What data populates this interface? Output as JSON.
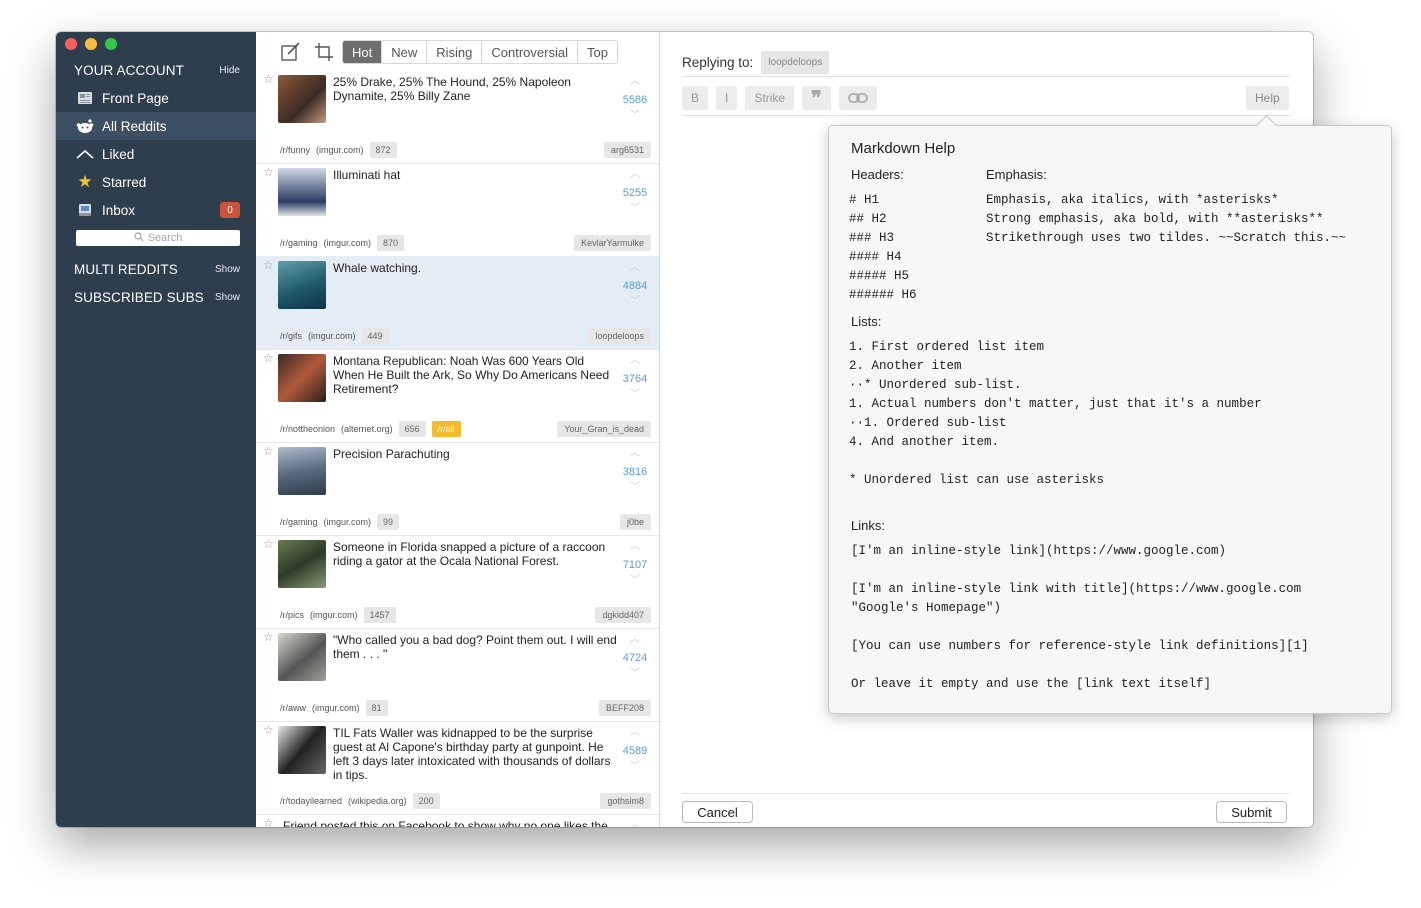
{
  "sidebar": {
    "account": {
      "label": "YOUR ACCOUNT",
      "action": "Hide"
    },
    "items": [
      {
        "label": "Front Page",
        "icon": "newspaper-icon"
      },
      {
        "label": "All Reddits",
        "icon": "reddit-alien-icon",
        "active": true
      },
      {
        "label": "Liked",
        "icon": "upvote-chevron-icon"
      },
      {
        "label": "Starred",
        "icon": "star-icon"
      },
      {
        "label": "Inbox",
        "icon": "inbox-icon",
        "badge": "0"
      }
    ],
    "search_placeholder": "Search",
    "multi": {
      "label": "MULTI REDDITS",
      "action": "Show"
    },
    "subscribed": {
      "label": "SUBSCRIBED SUBS",
      "action": "Show"
    }
  },
  "feed": {
    "tabs": [
      "Hot",
      "New",
      "Rising",
      "Controversial",
      "Top"
    ],
    "active_tab": "Hot",
    "posts": [
      {
        "title": "25% Drake, 25% The Hound, 25% Napoleon Dynamite, 25% Billy Zane",
        "score": "5586",
        "sub": "/r/funny",
        "domain": "(imgur.com)",
        "comments": "872",
        "author": "arg6531"
      },
      {
        "title": "Illuminati hat",
        "score": "5255",
        "sub": "/r/gaming",
        "domain": "(imgur.com)",
        "comments": "870",
        "author": "KevlarYarmulke"
      },
      {
        "title": "Whale watching.",
        "score": "4884",
        "sub": "/r/gifs",
        "domain": "(imgur.com)",
        "comments": "449",
        "author": "loopdeloops",
        "selected": true
      },
      {
        "title": "Montana Republican: Noah Was 600 Years Old When He Built the Ark, So Why Do Americans Need Retirement?",
        "score": "3764",
        "sub": "/r/nottheonion",
        "domain": "(alternet.org)",
        "comments": "656",
        "extra": "/r/all",
        "author": "Your_Gran_is_dead"
      },
      {
        "title": "Precision Parachuting",
        "score": "3816",
        "sub": "/r/gaming",
        "domain": "(imgur.com)",
        "comments": "99",
        "author": "j0be"
      },
      {
        "title": "Someone in Florida snapped a picture of a raccoon riding a gator at the Ocala National Forest.",
        "score": "7107",
        "sub": "/r/pics",
        "domain": "(imgur.com)",
        "comments": "1457",
        "author": "dgkidd407"
      },
      {
        "title": "\"Who called you a bad dog? Point them out. I will end them . . . \"",
        "score": "4724",
        "sub": "/r/aww",
        "domain": "(imgur.com)",
        "comments": "81",
        "author": "BEFF208"
      },
      {
        "title": "TIL Fats Waller was kidnapped to be the surprise guest at Al Capone's birthday party at gunpoint. He left 3 days later intoxicated with thousands of dollars in tips.",
        "score": "4589",
        "sub": "/r/todayilearned",
        "domain": "(wikipedia.org)",
        "comments": "200",
        "author": "gothsim8"
      },
      {
        "title": "Friend posted this on Facebook to show why no one likes the",
        "score": "",
        "sub": "",
        "domain": "",
        "comments": "",
        "author": ""
      }
    ]
  },
  "reply": {
    "replying_label": "Replying to:",
    "replying_user": "loopdeloops",
    "format_buttons": [
      "B",
      "I",
      "Strike"
    ],
    "quote_icon": "quote-icon",
    "link_icon": "link-icon",
    "help_label": "Help",
    "cancel_label": "Cancel",
    "submit_label": "Submit"
  },
  "help": {
    "title": "Markdown Help",
    "headers_label": "Headers:",
    "emphasis_label": "Emphasis:",
    "headers_text": "# H1\n## H2\n### H3\n#### H4\n##### H5\n###### H6",
    "emphasis_text": "Emphasis, aka italics, with *asterisks*\nStrong emphasis, aka bold, with **asterisks**\nStrikethrough uses two tildes. ~~Scratch this.~~",
    "lists_label": "Lists:",
    "lists_text": "1. First ordered list item\n2. Another item\n··* Unordered sub-list.\n1. Actual numbers don't matter, just that it's a number\n··1. Ordered sub-list\n4. And another item.\n\n* Unordered list can use asterisks",
    "links_label": "Links:",
    "links_text": "[I'm an inline-style link](https://www.google.com)\n\n[I'm an inline-style link with title](https://www.google.com\n\"Google's Homepage\")\n\n[You can use numbers for reference-style link definitions][1]\n\nOr leave it empty and use the [link text itself]"
  }
}
